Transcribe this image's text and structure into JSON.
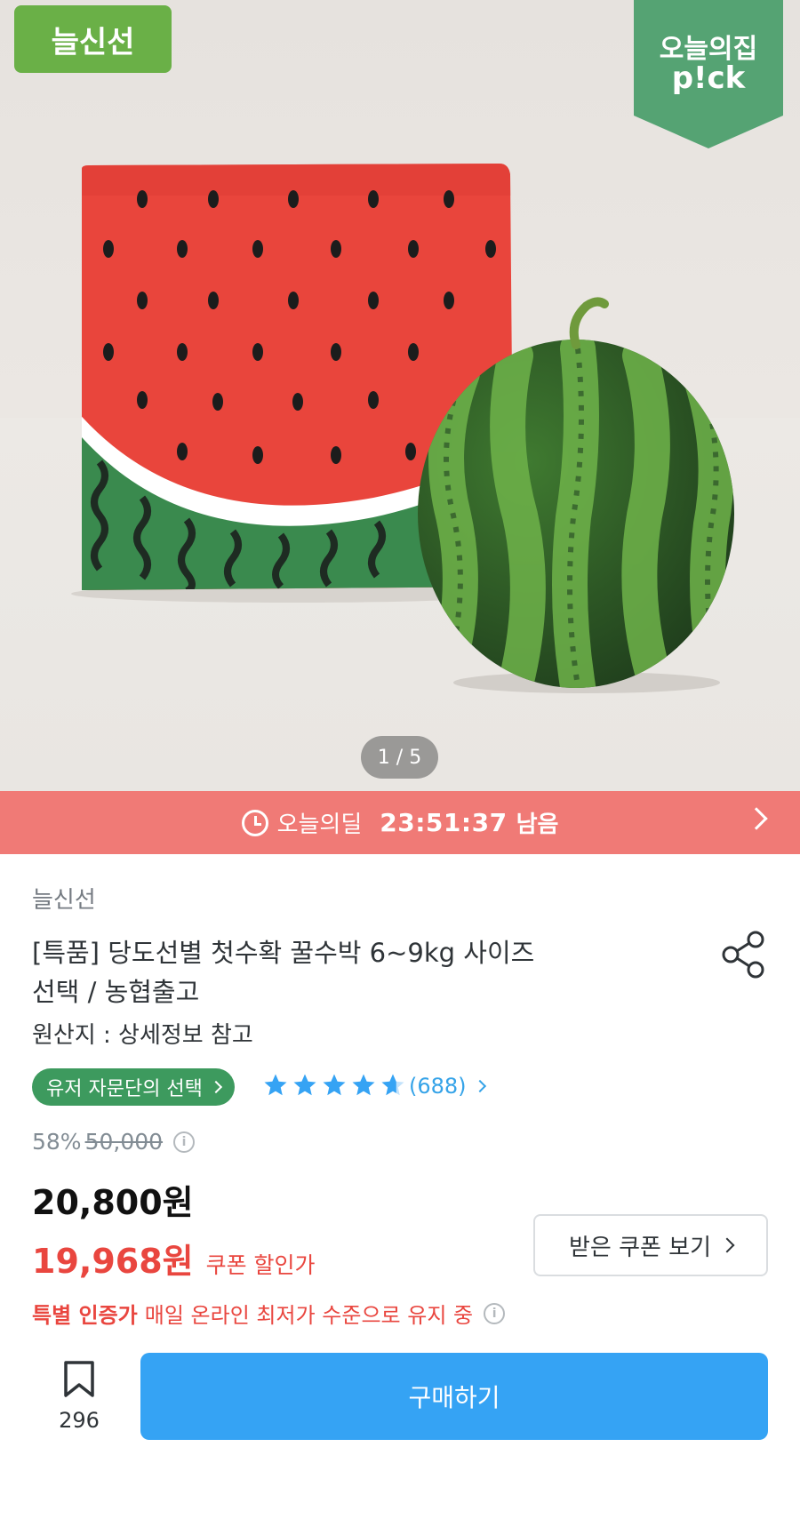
{
  "hero": {
    "fresh_badge": "늘신선",
    "pick_badge_line1": "오늘의집",
    "pick_badge_line2": "p!ck",
    "pager": "1 / 5",
    "colors": {
      "fresh_badge": "#6ab047",
      "pick_badge": "#55a373"
    }
  },
  "deal": {
    "label": "오늘의딜",
    "countdown": "23:51:37",
    "remaining": "남음",
    "color": "#f07a76"
  },
  "product": {
    "brand": "늘신선",
    "title_line1": "[특품] 당도선별  첫수확 꿀수박 6~9kg 사이즈",
    "title_line2": "선택 / 농협출고",
    "origin": "원산지 : 상세정보 참고",
    "choice_badge": "유저 자문단의 선택",
    "rating": 4.5,
    "review_count": "(688)",
    "discount_rate": "58%",
    "original_price": "50,000",
    "price": "20,800원",
    "coupon_price": "19,968원",
    "coupon_label": "쿠폰 할인가",
    "coupon_button": "받은 쿠폰 보기",
    "cert_strong": "특별 인증가",
    "cert_text": "매일 온라인 최저가 수준으로 유지 중"
  },
  "bottom": {
    "bookmark_count": "296",
    "buy_label": "구매하기",
    "buy_color": "#35a3f4"
  },
  "icons": [
    "clock-icon",
    "chevron-right-icon",
    "share-icon",
    "star-icon",
    "info-icon",
    "bookmark-icon"
  ]
}
